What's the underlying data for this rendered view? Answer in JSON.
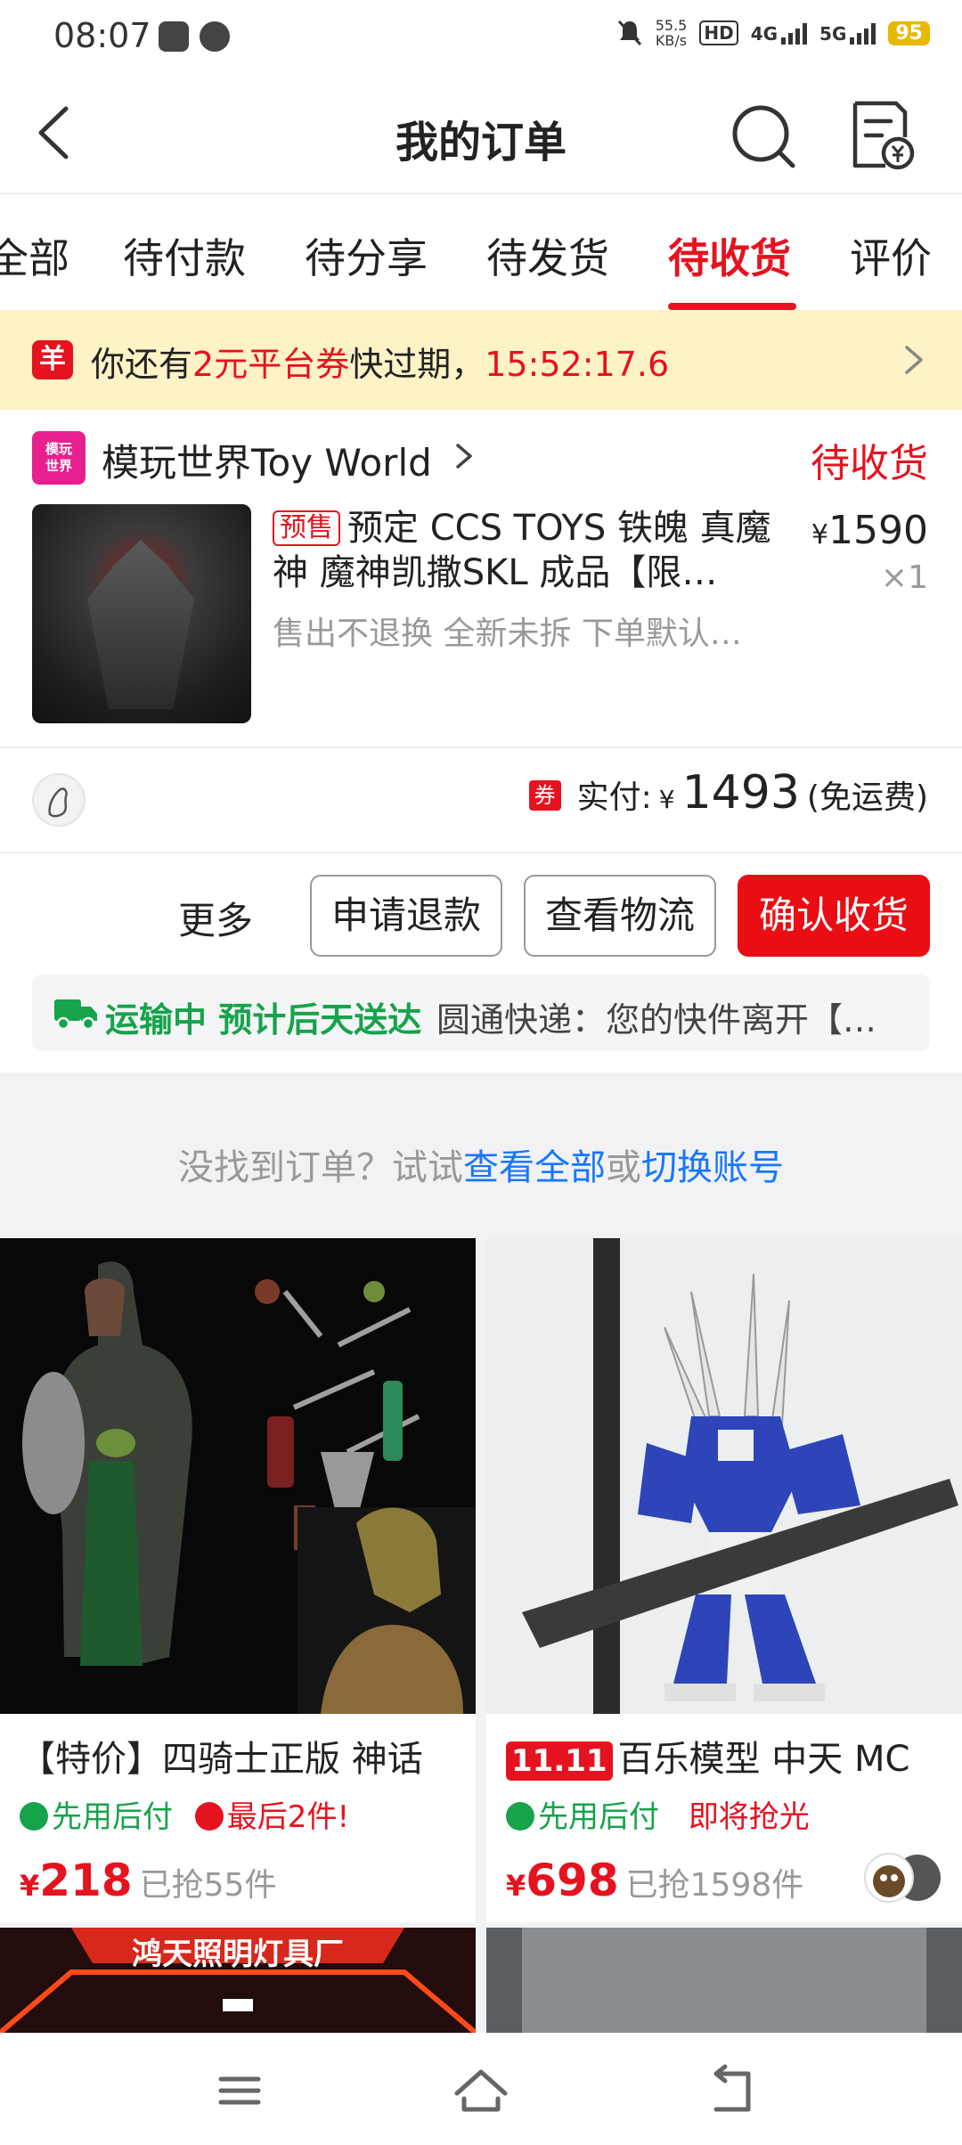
{
  "status_bar": {
    "time": "08:07",
    "net_speed_top": "55.5",
    "net_speed_bottom": "KB/s",
    "hd": "HD",
    "net1": "4G",
    "net2": "5G",
    "battery": "95"
  },
  "header": {
    "title": "我的订单"
  },
  "tabs": [
    {
      "label": "全部"
    },
    {
      "label": "待付款"
    },
    {
      "label": "待分享"
    },
    {
      "label": "待发货"
    },
    {
      "label": "待收货",
      "active": true
    },
    {
      "label": "评价"
    }
  ],
  "coupon": {
    "icon_char": "羊",
    "prefix": "你还有",
    "amount": "2元平台券",
    "middle": "快过期，",
    "countdown": "15:52:17.6"
  },
  "order": {
    "shop_logo_line1": "模玩",
    "shop_logo_line2": "世界",
    "shop_name": "模玩世界Toy World",
    "status": "待收货",
    "presale_tag": "预售",
    "product_title": "预定 CCS TOYS 铁魄 真魔神 魔神凯撒SKL 成品【限…",
    "product_sub": "售出不退换 全新未拆 下单默认…",
    "price_symbol": "¥",
    "price": "1590",
    "quantity": "×1",
    "coupon_tag": "券",
    "paid_label": "实付:",
    "paid_symbol": "¥",
    "paid_amount": "1493",
    "shipping_fee": "(免运费)",
    "actions": {
      "more": "更多",
      "refund": "申请退款",
      "logistics": "查看物流",
      "confirm": "确认收货"
    },
    "shipping": {
      "status": "运输中 预计后天送达",
      "detail": "圆通快递：您的快件离开【…"
    }
  },
  "not_found": {
    "prefix": "没找到订单？试试",
    "link1": "查看全部",
    "middle": "或",
    "link2": "切换账号"
  },
  "recommendations": [
    {
      "title": "【特价】四骑士正版 神话",
      "badge1": "先用后付",
      "badge2": "最后2件!",
      "price_symbol": "¥",
      "price": "218",
      "sold": "已抢55件"
    },
    {
      "tag": "11.11",
      "title": "百乐模型 中天 MC",
      "badge1": "先用后付",
      "badge2": "即将抢光",
      "price_symbol": "¥",
      "price": "698",
      "sold": "已抢1598件"
    }
  ],
  "next_row": {
    "banner_text": "鸿天照明灯具厂"
  },
  "colors": {
    "accent_red": "#e5131f",
    "link_blue": "#1677ff",
    "green": "#16a34a",
    "coupon_bg": "#fdf3c6"
  }
}
